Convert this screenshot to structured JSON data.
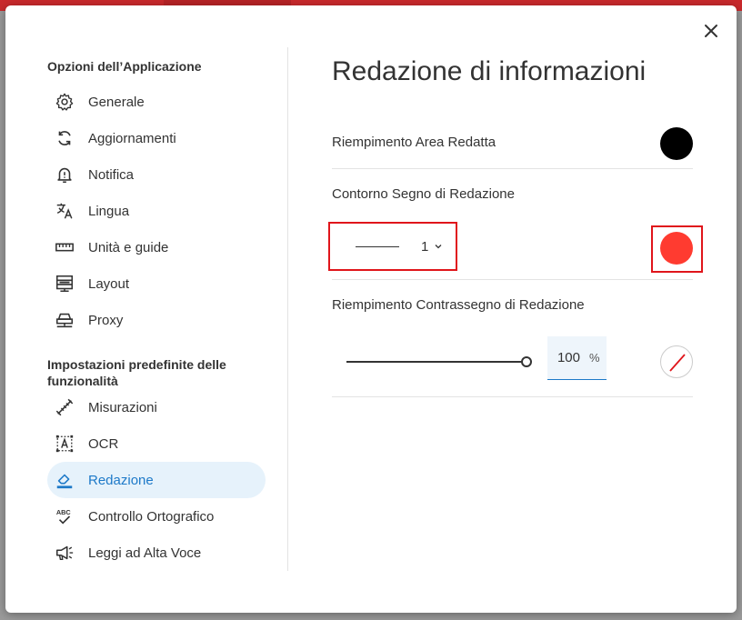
{
  "window": {
    "close_label": "Chiudi"
  },
  "sidebar": {
    "section1_title": "Opzioni dell’Applicazione",
    "section2_title": "Impostazioni predefinite delle funzionalità",
    "items": [
      {
        "label": "Generale",
        "icon": "gear-icon"
      },
      {
        "label": "Aggiornamenti",
        "icon": "sync-icon"
      },
      {
        "label": "Notifica",
        "icon": "bell-icon"
      },
      {
        "label": "Lingua",
        "icon": "translate-icon"
      },
      {
        "label": "Unità e guide",
        "icon": "ruler-icon"
      },
      {
        "label": "Layout",
        "icon": "layout-icon"
      },
      {
        "label": "Proxy",
        "icon": "proxy-icon"
      },
      {
        "label": "Misurazioni",
        "icon": "measure-icon"
      },
      {
        "label": "OCR",
        "icon": "ocr-icon"
      },
      {
        "label": "Redazione",
        "icon": "eraser-icon",
        "active": true
      },
      {
        "label": "Controllo Ortografico",
        "icon": "spellcheck-icon"
      },
      {
        "label": "Leggi ad Alta Voce",
        "icon": "megaphone-icon"
      }
    ]
  },
  "main": {
    "title": "Redazione di informazioni",
    "fill_label": "Riempimento Area Redatta",
    "fill_color": "#000000",
    "outline_label": "Contorno Segno di Redazione",
    "outline_width": "1",
    "outline_color": "#ff3b30",
    "mark_fill_label": "Riempimento Contrassegno di Redazione",
    "opacity_value": "100",
    "opacity_fraction": 1.0,
    "opacity_unit": "%",
    "mark_fill_color": "none"
  },
  "colors": {
    "accent": "#1d79c8",
    "highlight": "#e0151b"
  }
}
